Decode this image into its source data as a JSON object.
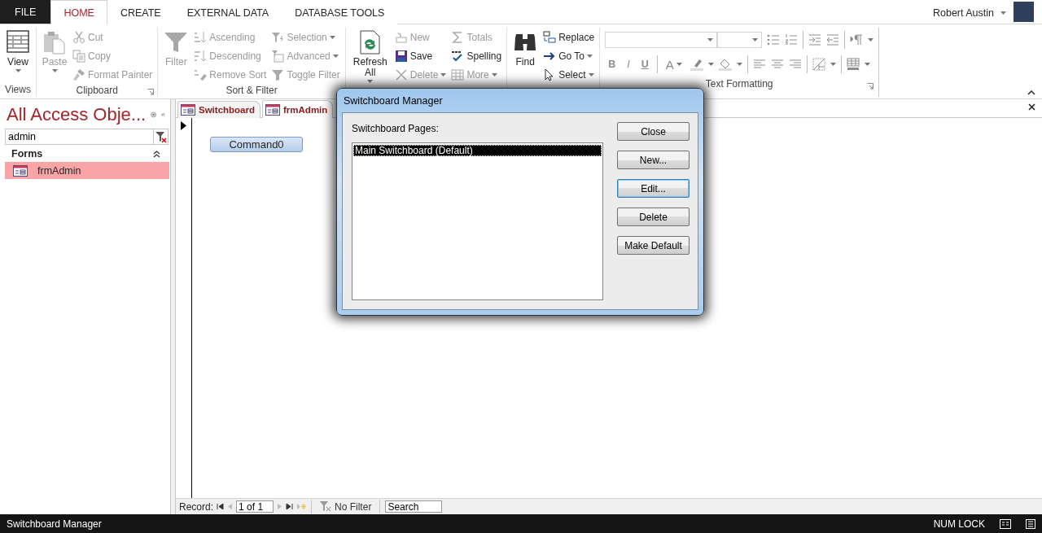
{
  "ribbon_tabs": [
    {
      "label": "FILE",
      "kind": "file",
      "selected": false
    },
    {
      "label": "HOME",
      "kind": "tab",
      "selected": true
    },
    {
      "label": "CREATE",
      "kind": "tab",
      "selected": false
    },
    {
      "label": "EXTERNAL DATA",
      "kind": "tab",
      "selected": false
    },
    {
      "label": "DATABASE TOOLS",
      "kind": "tab",
      "selected": false
    }
  ],
  "account": {
    "user_name": "Robert Austin"
  },
  "ribbon_groups": [
    {
      "label": "Views",
      "launcher": false,
      "large": {
        "label": "View",
        "disabled": false,
        "dropdown": true
      }
    },
    {
      "label": "Clipboard",
      "launcher": true,
      "large": {
        "label": "Paste",
        "disabled": true,
        "dropdown": true
      },
      "columns": [
        [
          {
            "label": "Cut",
            "disabled": true,
            "dropdown": false
          },
          {
            "label": "Copy",
            "disabled": true,
            "dropdown": false
          },
          {
            "label": "Format Painter",
            "disabled": true,
            "dropdown": false
          }
        ]
      ]
    },
    {
      "label": "Sort & Filter",
      "launcher": false,
      "large": {
        "label": "Filter",
        "disabled": true,
        "dropdown": false
      },
      "columns": [
        [
          {
            "label": "Ascending",
            "disabled": true,
            "dropdown": false
          },
          {
            "label": "Descending",
            "disabled": true,
            "dropdown": false
          },
          {
            "label": "Remove Sort",
            "disabled": true,
            "dropdown": false
          }
        ],
        [
          {
            "label": "Selection",
            "disabled": true,
            "dropdown": true
          },
          {
            "label": "Advanced",
            "disabled": true,
            "dropdown": true
          },
          {
            "label": "Toggle Filter",
            "disabled": true,
            "dropdown": false
          }
        ]
      ]
    },
    {
      "launcher": false,
      "large": {
        "label": "Refresh All",
        "disabled": false,
        "dropdown": true
      },
      "columns": [
        [
          {
            "label": "New",
            "disabled": true,
            "dropdown": false
          },
          {
            "label": "Save",
            "disabled": false,
            "dropdown": false
          },
          {
            "label": "Delete",
            "disabled": true,
            "dropdown": true
          }
        ],
        [
          {
            "label": "Totals",
            "disabled": true,
            "dropdown": false
          },
          {
            "label": "Spelling",
            "disabled": false,
            "dropdown": false
          },
          {
            "label": "More",
            "disabled": true,
            "dropdown": true
          }
        ]
      ]
    },
    {
      "launcher": false,
      "large": {
        "label": "Find",
        "disabled": false,
        "dropdown": false
      },
      "columns": [
        [
          {
            "label": "Replace",
            "disabled": false,
            "dropdown": false
          },
          {
            "label": "Go To",
            "disabled": false,
            "dropdown": true
          },
          {
            "label": "Select",
            "disabled": false,
            "dropdown": true
          }
        ]
      ]
    }
  ],
  "text_formatting": {
    "label": "Text Formatting",
    "launcher": true,
    "disabled": true,
    "style_buttons": [
      "B",
      "I",
      "U"
    ],
    "font_color_button": "A"
  },
  "navigation_pane": {
    "title": "All Access Obje...",
    "search": {
      "value": "admin"
    },
    "groups": [
      {
        "label": "Forms",
        "expanded": true,
        "items": [
          {
            "label": "frmAdmin",
            "selected": true
          }
        ]
      }
    ]
  },
  "documents": {
    "tabs": [
      {
        "label": "Switchboard",
        "selected": false
      },
      {
        "label": "frmAdmin",
        "selected": true
      }
    ],
    "form": {
      "button": "Command0"
    },
    "record_nav": {
      "label": "Record:",
      "position": "1 of 1",
      "filter": "No Filter",
      "search": {
        "placeholder": "Search"
      }
    }
  },
  "dialog": {
    "title": "Switchboard Manager",
    "list_label": "Switchboard Pages:",
    "pages": [
      {
        "label": "Main Switchboard (Default)",
        "selected": true
      }
    ],
    "buttons": [
      {
        "label": "Close",
        "focused": false
      },
      {
        "label": "New...",
        "focused": false
      },
      {
        "label": "Edit...",
        "focused": true
      },
      {
        "label": "Delete",
        "focused": false
      },
      {
        "label": "Make Default",
        "focused": false
      }
    ]
  },
  "status_bar": {
    "message": "Switchboard Manager",
    "indicators": [
      "NUM LOCK"
    ]
  }
}
